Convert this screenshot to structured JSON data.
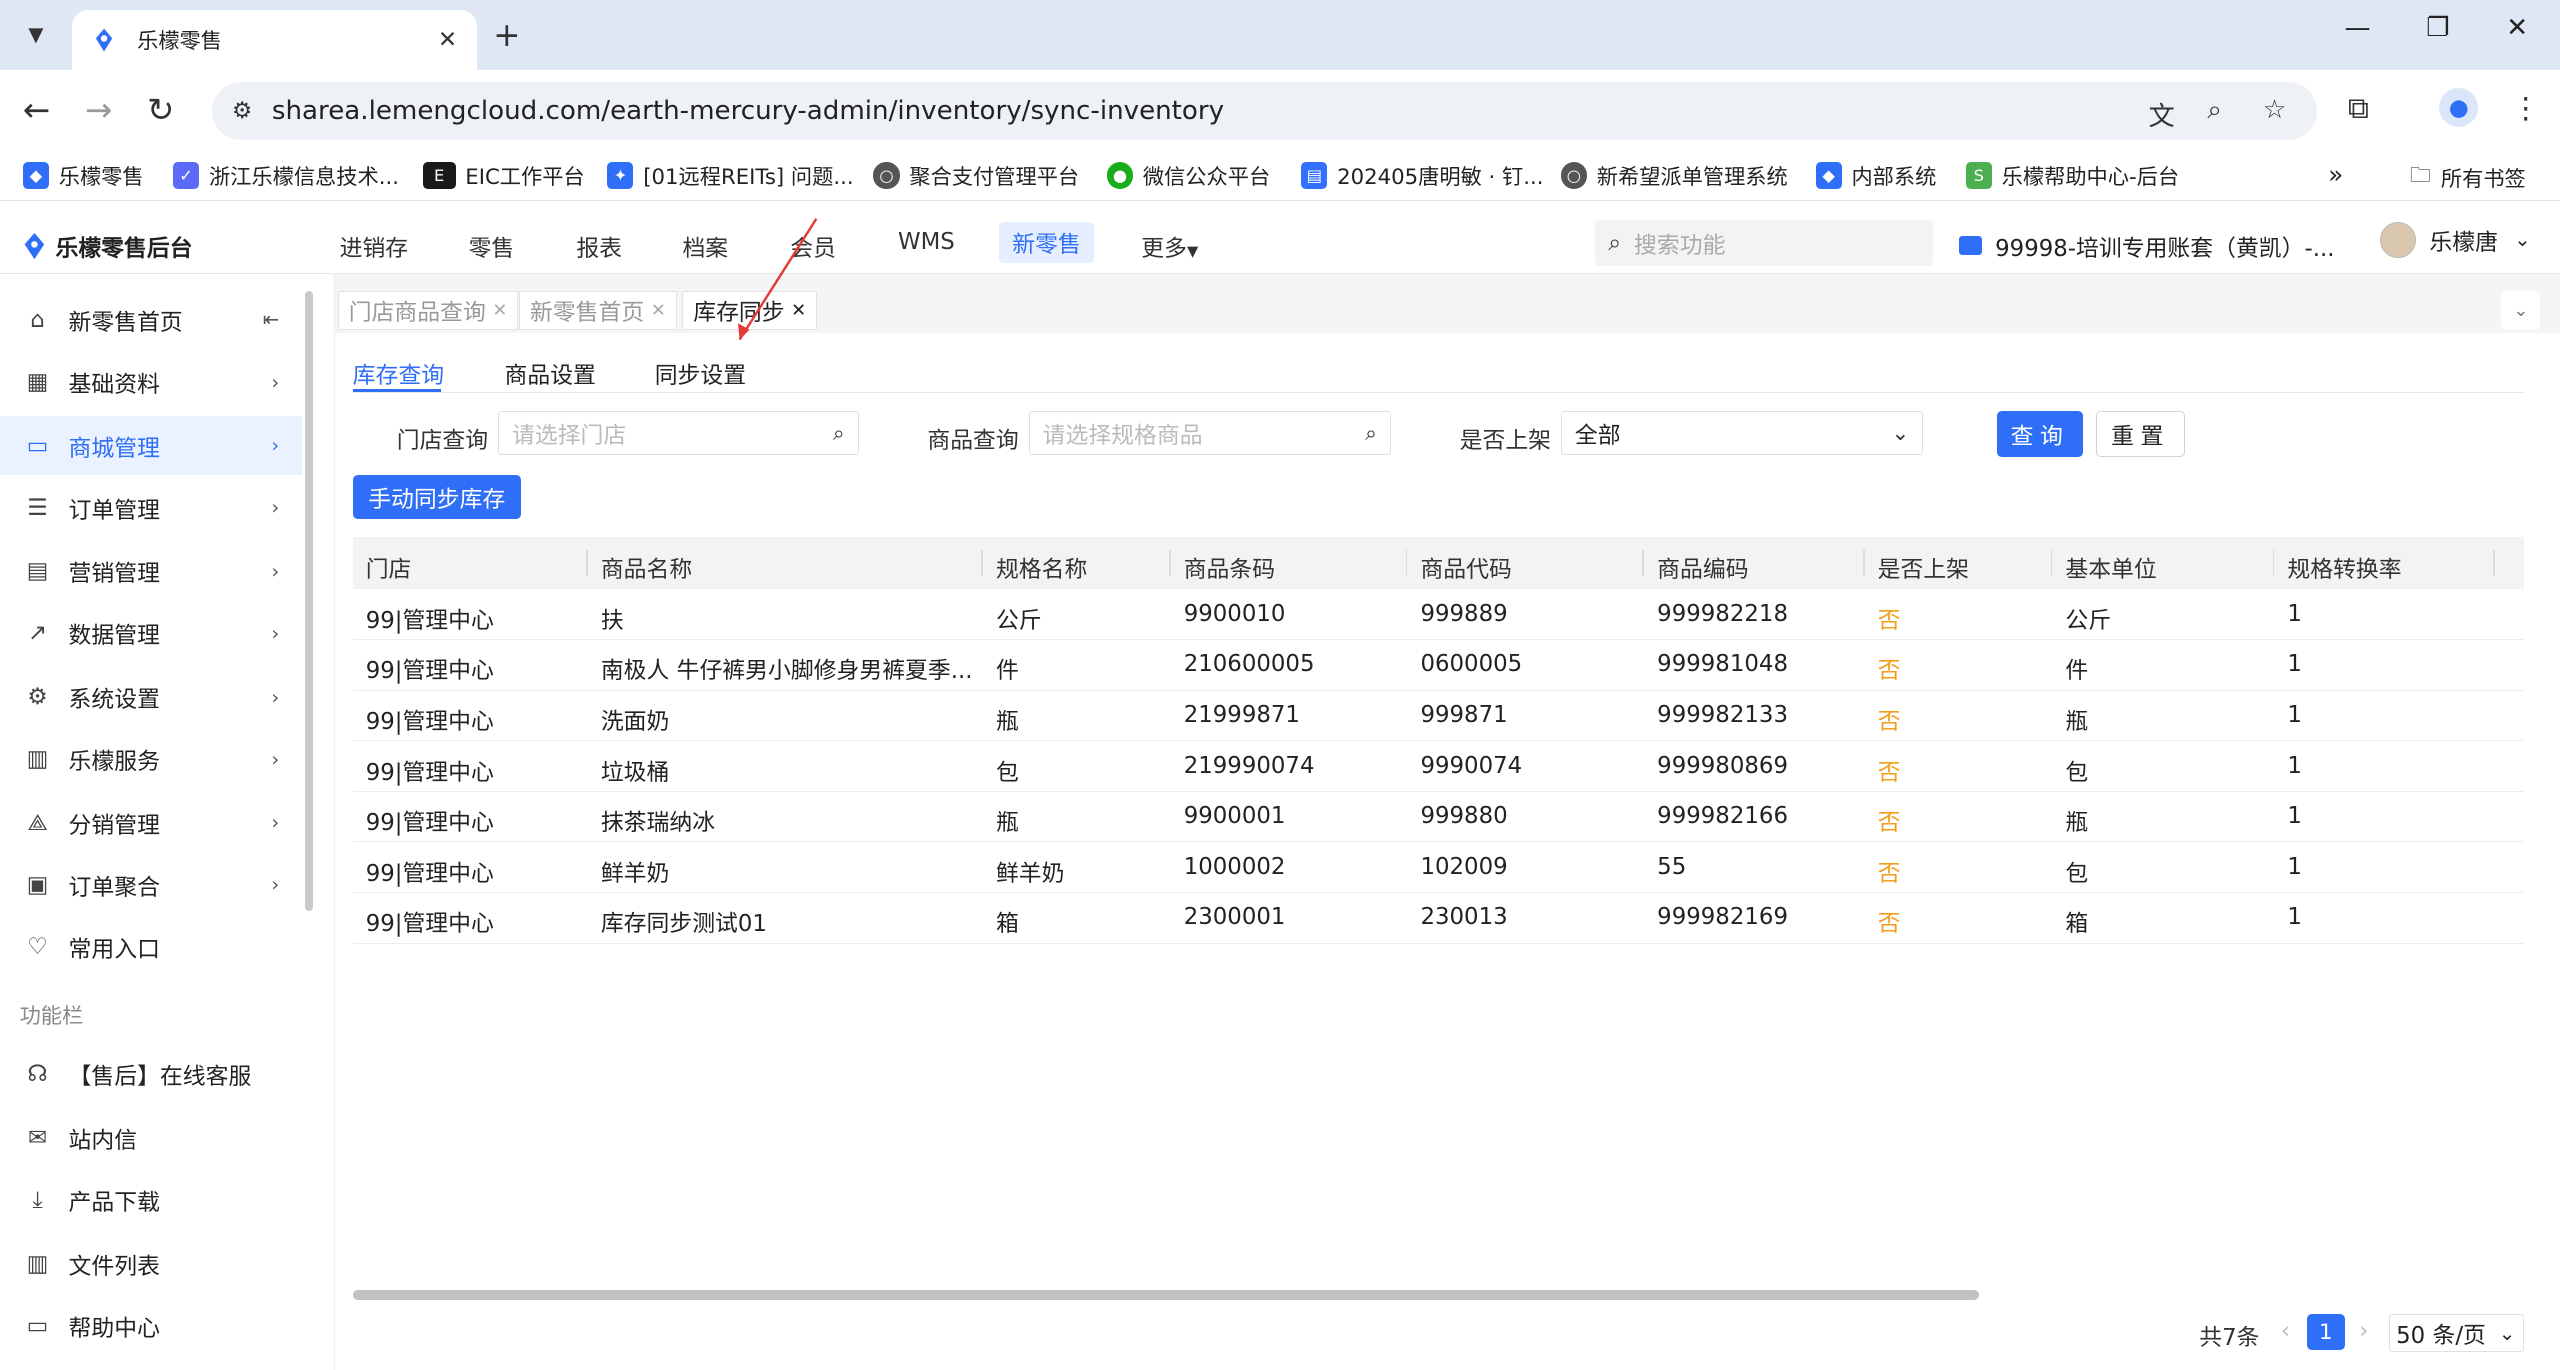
{
  "browser": {
    "tab_title": "乐檬零售",
    "url": "sharea.lemengcloud.com/earth-mercury-admin/inventory/sync-inventory",
    "bookmarks": [
      {
        "label": "乐檬零售",
        "color": "#2f6ef6"
      },
      {
        "label": "浙江乐檬信息技术...",
        "color": "#5b6bf6"
      },
      {
        "label": "EIC工作平台",
        "color": "#1a1a1a"
      },
      {
        "label": "[01远程REITs] 问题...",
        "color": "#2f6ef6"
      },
      {
        "label": "聚合支付管理平台",
        "color": "#555555"
      },
      {
        "label": "微信公众平台",
        "color": "#1aad19"
      },
      {
        "label": "202405唐明敏 · 钉...",
        "color": "#3370ff"
      },
      {
        "label": "新希望派单管理系统",
        "color": "#555555"
      },
      {
        "label": "内部系统",
        "color": "#2f6ef6"
      },
      {
        "label": "乐檬帮助中心-后台",
        "color": "#4caf50"
      }
    ],
    "all_bookmarks": "所有书签"
  },
  "app": {
    "logo": "乐檬零售后台",
    "nav": [
      "进销存",
      "零售",
      "报表",
      "档案",
      "会员",
      "WMS",
      "新零售",
      "更多"
    ],
    "search_placeholder": "搜索功能",
    "account": "99998-培训专用账套（黄凯）-...",
    "user": "乐檬唐"
  },
  "sidebar": {
    "items": [
      {
        "label": "新零售首页",
        "icon": "home-icon"
      },
      {
        "label": "基础资料",
        "icon": "grid-icon"
      },
      {
        "label": "商城管理",
        "icon": "shop-icon"
      },
      {
        "label": "订单管理",
        "icon": "order-icon"
      },
      {
        "label": "营销管理",
        "icon": "marketing-icon"
      },
      {
        "label": "数据管理",
        "icon": "chart-icon"
      },
      {
        "label": "系统设置",
        "icon": "settings-icon"
      },
      {
        "label": "乐檬服务",
        "icon": "service-icon"
      },
      {
        "label": "分销管理",
        "icon": "distribution-icon"
      },
      {
        "label": "订单聚合",
        "icon": "aggregate-icon"
      },
      {
        "label": "常用入口",
        "icon": "heart-icon"
      }
    ],
    "section_label": "功能栏",
    "func_items": [
      {
        "label": "【售后】在线客服",
        "icon": "headset-icon"
      },
      {
        "label": "站内信",
        "icon": "mail-icon"
      },
      {
        "label": "产品下载",
        "icon": "download-icon"
      },
      {
        "label": "文件列表",
        "icon": "file-list-icon"
      },
      {
        "label": "帮助中心",
        "icon": "help-icon"
      }
    ]
  },
  "page_tabs": [
    "门店商品查询",
    "新零售首页",
    "库存同步"
  ],
  "sub_tabs": [
    "库存查询",
    "商品设置",
    "同步设置"
  ],
  "filters": {
    "store_label": "门店查询",
    "store_placeholder": "请选择门店",
    "product_label": "商品查询",
    "product_placeholder": "请选择规格商品",
    "listed_label": "是否上架",
    "listed_value": "全部",
    "query_button": "查询",
    "reset_button": "重置"
  },
  "sync_button": "手动同步库存",
  "table": {
    "columns": [
      "门店",
      "商品名称",
      "规格名称",
      "商品条码",
      "商品代码",
      "商品编码",
      "是否上架",
      "基本单位",
      "规格转换率"
    ],
    "rows": [
      [
        "99|管理中心",
        "扶",
        "公斤",
        "9900010",
        "999889",
        "999982218",
        "否",
        "公斤",
        "1"
      ],
      [
        "99|管理中心",
        "南极人 牛仔裤男小脚修身男裤夏季...",
        "件",
        "210600005",
        "0600005",
        "999981048",
        "否",
        "件",
        "1"
      ],
      [
        "99|管理中心",
        "洗面奶",
        "瓶",
        "21999871",
        "999871",
        "999982133",
        "否",
        "瓶",
        "1"
      ],
      [
        "99|管理中心",
        "垃圾桶",
        "包",
        "219990074",
        "9990074",
        "999980869",
        "否",
        "包",
        "1"
      ],
      [
        "99|管理中心",
        "抹茶瑞纳冰",
        "瓶",
        "9900001",
        "999880",
        "999982166",
        "否",
        "瓶",
        "1"
      ],
      [
        "99|管理中心",
        "鲜羊奶",
        "鲜羊奶",
        "1000002",
        "102009",
        "55",
        "否",
        "包",
        "1"
      ],
      [
        "99|管理中心",
        "库存同步测试01",
        "箱",
        "2300001",
        "230013",
        "999982169",
        "否",
        "箱",
        "1"
      ]
    ]
  },
  "pagination": {
    "total": "共7条",
    "current": "1",
    "page_size": "50 条/页"
  }
}
